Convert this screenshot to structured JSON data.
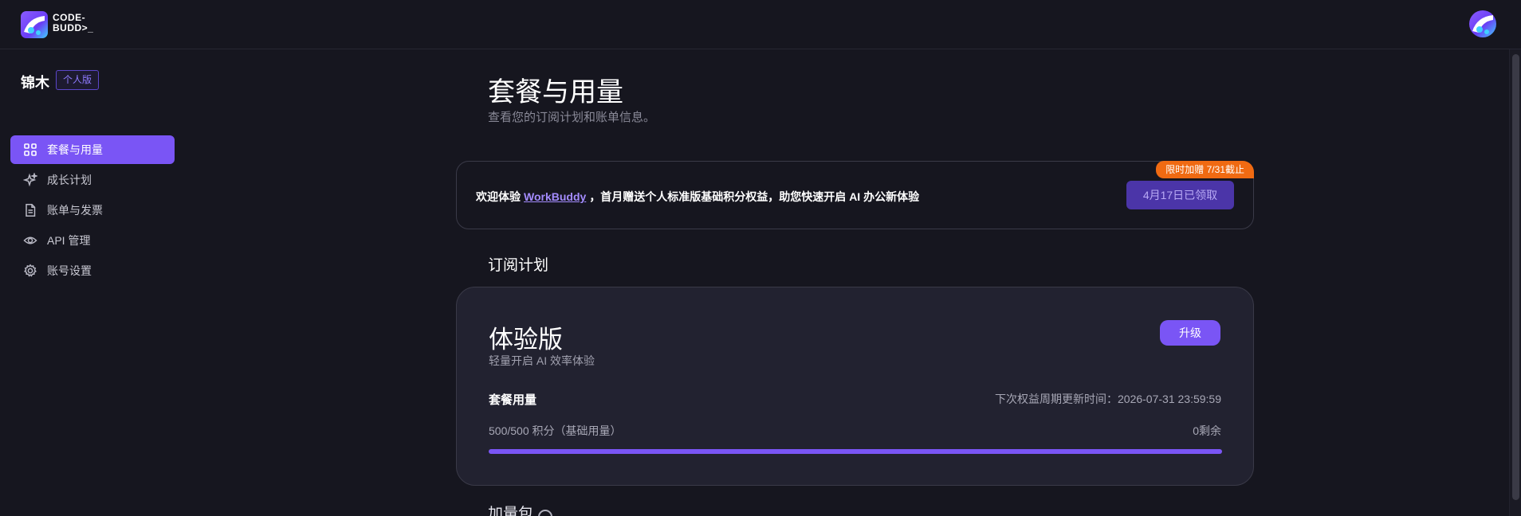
{
  "header": {
    "logo_line1": "CODE-",
    "logo_line2": "BUDD>_"
  },
  "sidebar": {
    "org_name": "锦木",
    "org_badge": "个人版",
    "items": [
      {
        "label": "套餐与用量",
        "icon": "grid-icon",
        "active": true
      },
      {
        "label": "成长计划",
        "icon": "sparkle-icon",
        "active": false
      },
      {
        "label": "账单与发票",
        "icon": "document-icon",
        "active": false
      },
      {
        "label": "API 管理",
        "icon": "eye-icon",
        "active": false
      },
      {
        "label": "账号设置",
        "icon": "gear-icon",
        "active": false
      }
    ]
  },
  "main": {
    "title": "套餐与用量",
    "subtitle": "查看您的订阅计划和账单信息。",
    "promo": {
      "text_before": "欢迎体验",
      "link_text": "WorkBuddy",
      "text_after": "，首月赠送个人标准版基础积分权益，助您快速开启 AI 办公新体验",
      "ribbon": "限时加赠 7/31截止",
      "button_label": "4月17日已领取"
    },
    "section_title": "订阅计划",
    "plan": {
      "name": "体验版",
      "description": "轻量开启 AI 效率体验",
      "upgrade_label": "升级",
      "usage_label": "套餐用量",
      "renew_text": "下次权益周期更新时间：2026-07-31 23:59:59",
      "usage_count": "500/500 积分（基础用量）",
      "remaining": "0剩余",
      "progress_percent": 100
    },
    "next_section_partial": "加量包"
  },
  "colors": {
    "accent": "#7a55f5",
    "ribbon": "#f06a12",
    "background": "#16161f",
    "card": "#222230"
  }
}
